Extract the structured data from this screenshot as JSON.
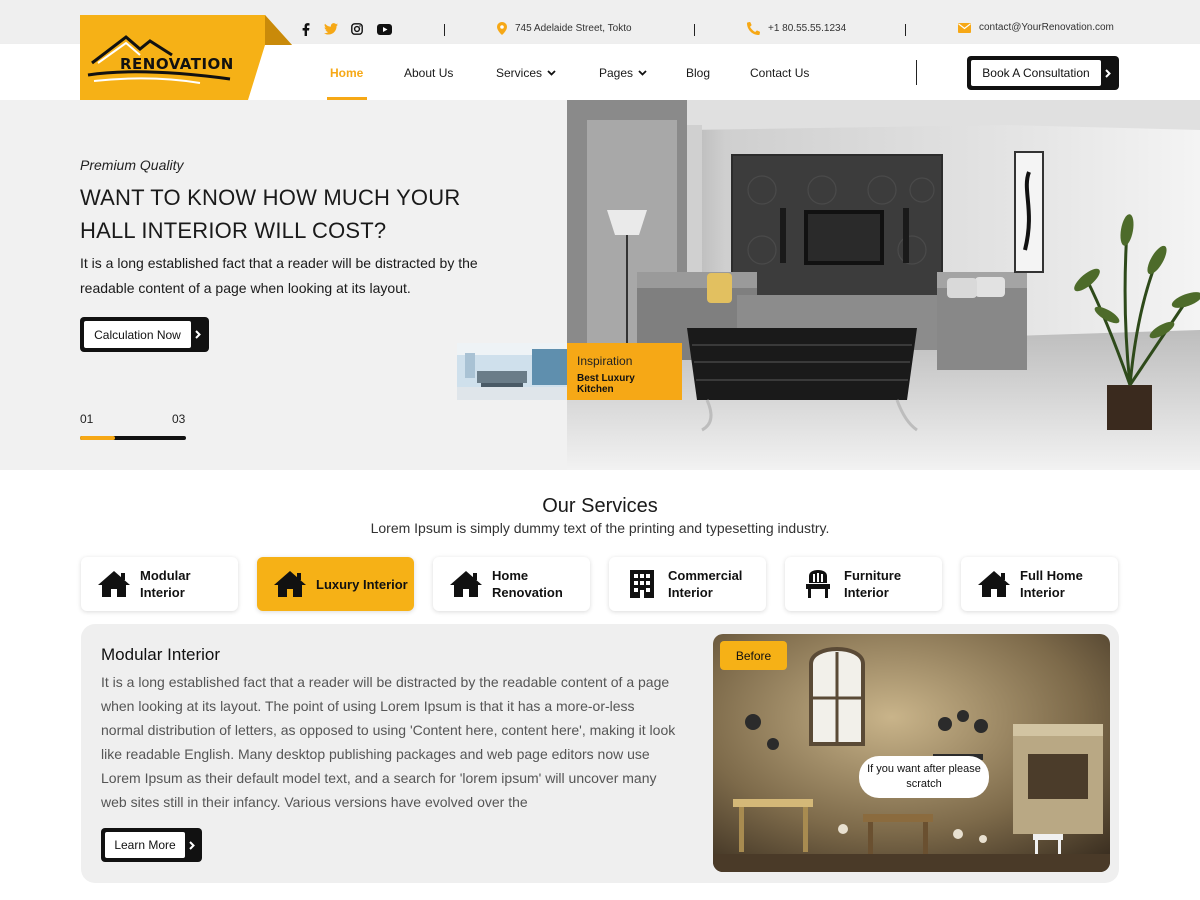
{
  "brand": {
    "logo_text": "RENOVATION"
  },
  "colors": {
    "accent": "#f6a816",
    "dark": "#111111",
    "hero_bg": "#f1f1f1",
    "panel_bg": "#efefef"
  },
  "topbar": {
    "social": [
      "facebook-icon",
      "twitter-icon",
      "instagram-icon",
      "youtube-icon"
    ],
    "address": "745 Adelaide Street, Tokto",
    "phone": "+1  80.55.55.1234",
    "email": "contact@YourRenovation.com"
  },
  "nav": {
    "items": [
      {
        "label": "Home",
        "active": true
      },
      {
        "label": "About Us"
      },
      {
        "label": "Services",
        "dropdown": true
      },
      {
        "label": "Pages",
        "dropdown": true
      },
      {
        "label": "Blog"
      },
      {
        "label": "Contact Us"
      }
    ],
    "cta": "Book A Consultation"
  },
  "hero": {
    "kicker": "Premium Quality",
    "title": "WANT TO KNOW HOW MUCH YOUR HALL INTERIOR WILL COST?",
    "text": "It is a long established fact that a reader will be distracted by the readable content of a page when looking at its layout.",
    "cta": "Calculation Now",
    "slide_current": "01",
    "slide_total": "03",
    "progress": 0.33,
    "thumb_kicker": "Inspiration",
    "thumb_title": "Best Luxury Kitchen"
  },
  "services": {
    "title": "Our Services",
    "subtitle": "Lorem Ipsum is simply dummy text of the printing and typesetting industry.",
    "tabs": [
      {
        "label": "Modular Interior",
        "icon": "house-icon"
      },
      {
        "label": "Luxury Interior",
        "icon": "house-icon",
        "active": true
      },
      {
        "label": "Home Renovation",
        "icon": "house-icon"
      },
      {
        "label": "Commercial Interior",
        "icon": "building-icon"
      },
      {
        "label": "Furniture Interior",
        "icon": "chair-icon"
      },
      {
        "label": "Full Home Interior",
        "icon": "house-icon"
      }
    ],
    "panel": {
      "title": "Modular Interior",
      "text": "It is a long established fact that a reader will be distracted by the readable content of a page when looking at its layout. The point of using Lorem Ipsum is that it has a more-or-less normal distribution of letters, as opposed to using 'Content here, content here', making it look like readable English. Many desktop publishing packages and web page editors now use Lorem Ipsum as their default model text, and a search for 'lorem ipsum' will uncover many web sites still in their infancy. Various versions have evolved over the",
      "cta": "Learn More",
      "badge": "Before",
      "scratch_hint": "If you want after please scratch"
    }
  }
}
